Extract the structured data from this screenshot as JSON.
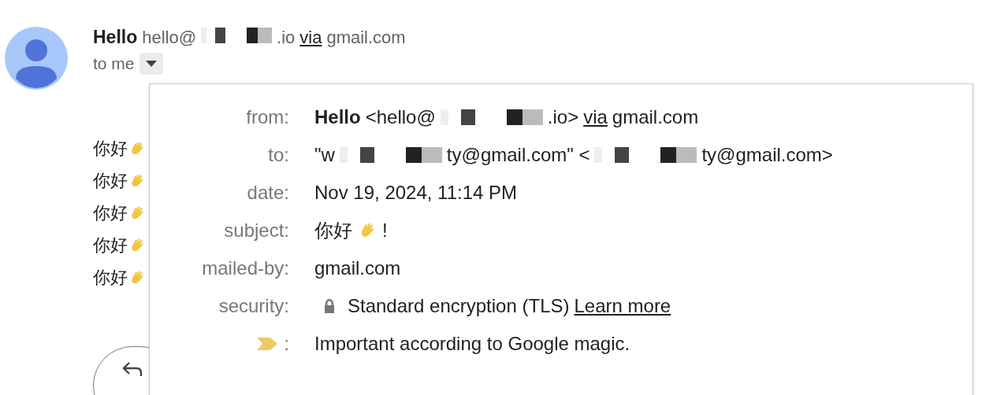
{
  "sender": {
    "name": "Hello",
    "address_parts": [
      {
        "kind": "text",
        "text": "hello@"
      },
      {
        "kind": "redacted"
      },
      {
        "kind": "text",
        "text": ".io"
      }
    ],
    "via_link": "via",
    "via_domain": "gmail.com"
  },
  "recipient_toggle": {
    "label": "to me",
    "expanded": true
  },
  "body_lines": [
    {
      "text": "你好"
    },
    {
      "text": "你好"
    },
    {
      "text": "你好"
    },
    {
      "text": "你好"
    },
    {
      "text": "你好"
    }
  ],
  "details": [
    {
      "kind": "field",
      "label": "from:",
      "parts": [
        {
          "kind": "strong",
          "text": "Hello"
        },
        {
          "kind": "text",
          "text": "<hello@"
        },
        {
          "kind": "redacted"
        },
        {
          "kind": "text",
          "text": ".io>"
        },
        {
          "kind": "link",
          "text": "via"
        },
        {
          "kind": "text",
          "text": "gmail.com"
        }
      ]
    },
    {
      "kind": "field",
      "label": "to:",
      "parts": [
        {
          "kind": "text",
          "text": "\"w"
        },
        {
          "kind": "redacted"
        },
        {
          "kind": "text",
          "text": "ty@gmail.com\" <"
        },
        {
          "kind": "redacted"
        },
        {
          "kind": "text",
          "text": "ty@gmail.com>"
        }
      ]
    },
    {
      "kind": "field",
      "label": "date:",
      "parts": [
        {
          "kind": "text",
          "text": "Nov 19, 2024, 11:14 PM"
        }
      ]
    },
    {
      "kind": "field",
      "label": "subject:",
      "parts": [
        {
          "kind": "text",
          "text": "你好"
        },
        {
          "kind": "wave"
        },
        {
          "kind": "text",
          "text": "!"
        }
      ]
    },
    {
      "kind": "field",
      "label": "mailed-by:",
      "parts": [
        {
          "kind": "text",
          "text": "gmail.com"
        }
      ]
    },
    {
      "kind": "field",
      "label": "security:",
      "parts": [
        {
          "kind": "lock"
        },
        {
          "kind": "text",
          "text": "Standard encryption (TLS)"
        },
        {
          "kind": "link",
          "text": "Learn more"
        }
      ]
    },
    {
      "kind": "importance",
      "label": ":",
      "parts": [
        {
          "kind": "text",
          "text": "Important according to Google magic."
        }
      ]
    }
  ]
}
